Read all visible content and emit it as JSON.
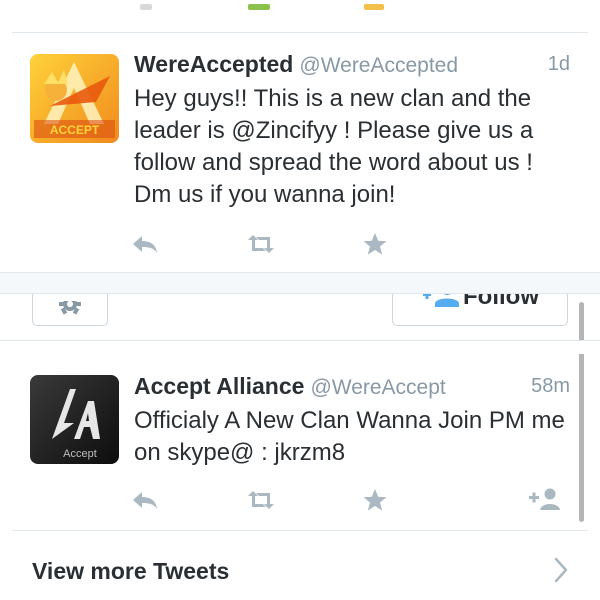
{
  "tweets": [
    {
      "name": "WereAccepted",
      "handle": "@WereAccepted",
      "time": "1d",
      "text": "Hey guys!! This is a new clan and the leader is @Zincifyy ! Please give us a follow and spread the word about us ! Dm us if you wanna join!",
      "avatar_text": "ACCEPT",
      "avatar_icon": "accept-logo-orange"
    },
    {
      "name": "Accept Alliance",
      "handle": "@WereAccept",
      "time": "58m",
      "text": "Officialy A New Clan Wanna Join PM me on skype@ : jkrzm8",
      "avatar_text": "Accept",
      "avatar_icon": "accept-logo-black"
    }
  ],
  "middle_card": {
    "follow_label": "Follow",
    "settings_icon": "gear-icon",
    "follow_icon": "follow-user-icon"
  },
  "footer": {
    "view_more_label": "View more Tweets",
    "chevron_icon": "chevron-right-icon"
  },
  "colors": {
    "text": "#292f33",
    "muted": "#8899a6",
    "action_icon": "#aab8c2",
    "follow_blue": "#55acee",
    "divider": "#e1e8ed"
  }
}
